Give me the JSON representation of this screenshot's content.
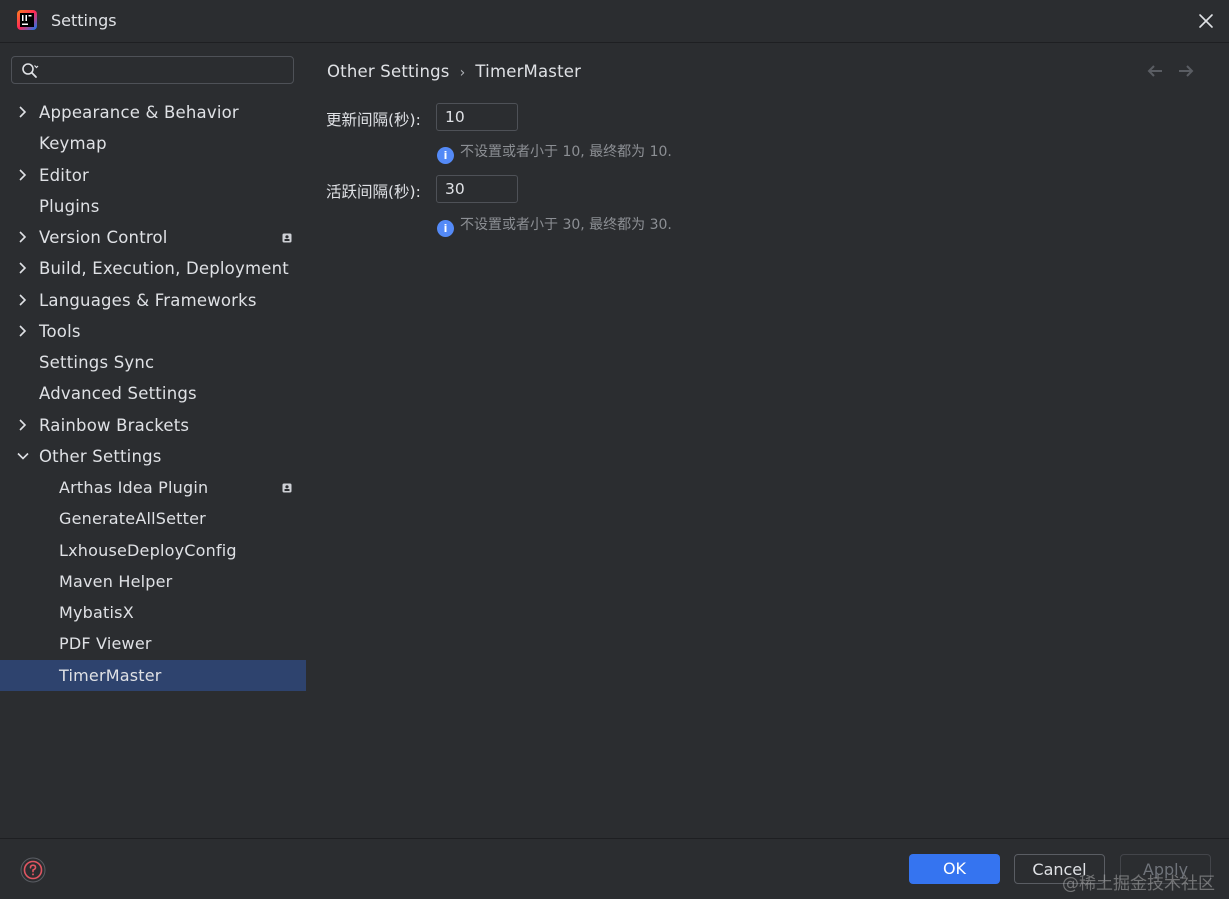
{
  "window": {
    "title": "Settings"
  },
  "sidebar": {
    "search": {
      "value": "",
      "placeholder": ""
    },
    "items": [
      {
        "label": "Appearance & Behavior",
        "expandable": true,
        "expanded": false
      },
      {
        "label": "Keymap",
        "expandable": false
      },
      {
        "label": "Editor",
        "expandable": true,
        "expanded": false
      },
      {
        "label": "Plugins",
        "expandable": false
      },
      {
        "label": "Version Control",
        "expandable": true,
        "expanded": false,
        "badge": true
      },
      {
        "label": "Build, Execution, Deployment",
        "expandable": true,
        "expanded": false
      },
      {
        "label": "Languages & Frameworks",
        "expandable": true,
        "expanded": false
      },
      {
        "label": "Tools",
        "expandable": true,
        "expanded": false
      },
      {
        "label": "Settings Sync",
        "expandable": false
      },
      {
        "label": "Advanced Settings",
        "expandable": false
      },
      {
        "label": "Rainbow Brackets",
        "expandable": true,
        "expanded": false
      },
      {
        "label": "Other Settings",
        "expandable": true,
        "expanded": true
      }
    ],
    "children": [
      {
        "label": "Arthas Idea Plugin",
        "badge": true
      },
      {
        "label": "GenerateAllSetter"
      },
      {
        "label": "LxhouseDeployConfig"
      },
      {
        "label": "Maven Helper"
      },
      {
        "label": "MybatisX"
      },
      {
        "label": "PDF Viewer"
      },
      {
        "label": "TimerMaster",
        "selected": true
      }
    ]
  },
  "breadcrumb": {
    "parent": "Other Settings",
    "separator": "›",
    "current": "TimerMaster"
  },
  "form": {
    "update_interval": {
      "label": "更新间隔(秒):",
      "value": "10",
      "hint": "不设置或者小于 10, 最终都为 10."
    },
    "active_interval": {
      "label": "活跃间隔(秒):",
      "value": "30",
      "hint": "不设置或者小于 30, 最终都为 30."
    },
    "info_glyph": "i"
  },
  "footer": {
    "ok_label": "OK",
    "cancel_label": "Cancel",
    "apply_label": "Apply",
    "watermark": "@稀土掘金技术社区"
  },
  "colors": {
    "background": "#2b2d30",
    "selection": "#2e436e",
    "accent": "#3574f0",
    "info": "#548af7",
    "help": "#e05561"
  }
}
